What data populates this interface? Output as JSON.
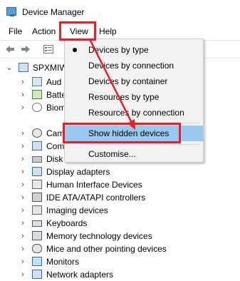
{
  "window": {
    "title": "Device Manager"
  },
  "menubar": {
    "items": [
      "File",
      "Action",
      "View",
      "Help"
    ]
  },
  "tree": {
    "root": "SPXMIW",
    "items": [
      {
        "label": "Aud"
      },
      {
        "label": "Batte"
      },
      {
        "label": "Biom"
      },
      {
        "label": "Cam"
      },
      {
        "label": "Com"
      },
      {
        "label": "Disk"
      },
      {
        "label": "Display adapters"
      },
      {
        "label": "Human Interface Devices"
      },
      {
        "label": "IDE ATA/ATAPI controllers"
      },
      {
        "label": "Imaging devices"
      },
      {
        "label": "Keyboards"
      },
      {
        "label": "Memory technology devices"
      },
      {
        "label": "Mice and other pointing devices"
      },
      {
        "label": "Monitors"
      },
      {
        "label": "Network adapters"
      }
    ]
  },
  "view_menu": {
    "items": [
      {
        "label": "Devices by type",
        "checked": true
      },
      {
        "label": "Devices by connection",
        "checked": false
      },
      {
        "label": "Devices by container",
        "checked": false
      },
      {
        "label": "Resources by type",
        "checked": false
      },
      {
        "label": "Resources by connection",
        "checked": false
      },
      {
        "label": "Show hidden devices",
        "highlighted": true
      },
      {
        "label": "Customise..."
      }
    ]
  },
  "colors": {
    "highlight": "#99c9ef",
    "annotation": "#e0222a"
  }
}
